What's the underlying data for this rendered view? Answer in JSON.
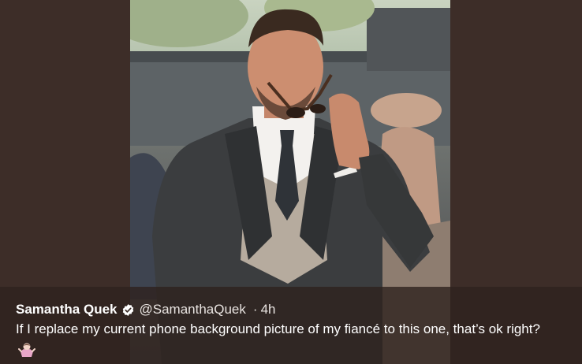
{
  "tweet": {
    "author_name": "Samantha Quek",
    "handle": "@SamanthaQuek",
    "separator": "·",
    "timestamp": "4h",
    "text": "If I replace my current phone background picture of my fiancé to this one, that’s ok right?",
    "verified": true
  },
  "icons": {
    "verified": "verified-badge-icon",
    "emoji": "person-shrugging-emoji"
  },
  "colors": {
    "background": "#3d2d28",
    "overlay": "#2e221e",
    "text": "#ffffff"
  }
}
